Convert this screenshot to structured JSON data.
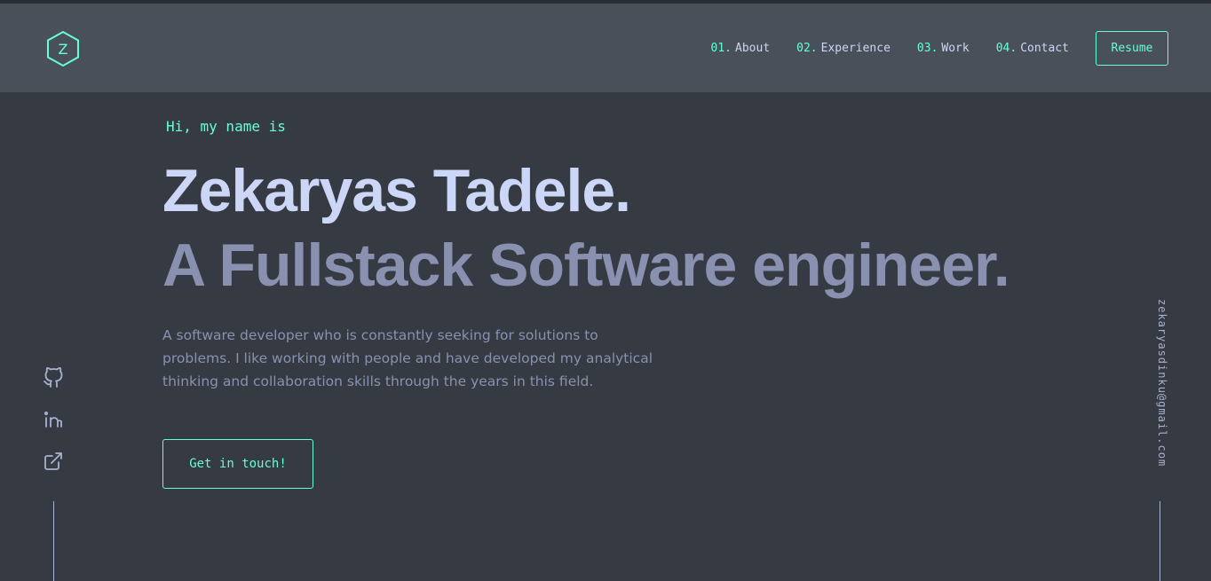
{
  "header": {
    "logo_letter": "Z",
    "nav": [
      {
        "num": "01.",
        "label": "About"
      },
      {
        "num": "02.",
        "label": "Experience"
      },
      {
        "num": "03.",
        "label": "Work"
      },
      {
        "num": "04.",
        "label": "Contact"
      }
    ],
    "resume_label": "Resume"
  },
  "hero": {
    "greeting": "Hi, my name is",
    "name": "Zekaryas Tadele.",
    "subtitle": "A Fullstack Software engineer.",
    "bio": "A software developer who is constantly seeking for solutions to problems. I like working with people and have developed my analytical thinking and collaboration skills through the years in this field.",
    "cta_label": "Get in touch!"
  },
  "social": {
    "icons": [
      "github-icon",
      "linkedin-icon",
      "external-link-icon"
    ]
  },
  "email": "zekaryasdinku@gmail.com",
  "colors": {
    "accent": "#64ffda",
    "background": "#363a43",
    "header_bg": "#4a5059",
    "heading": "#ccd6f6",
    "muted": "#8892b0"
  }
}
